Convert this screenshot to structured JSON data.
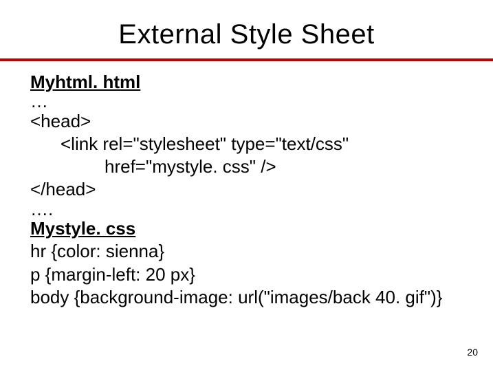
{
  "title": "External Style Sheet",
  "file1": "Myhtml. html",
  "dots1": "…",
  "line_head_open": "<head>",
  "line_link1": "<link rel=\"stylesheet\" type=\"text/css\"",
  "line_link2": "href=\"mystyle. css\" />",
  "line_head_close": "</head>",
  "dots2": "….",
  "file2": "Mystyle. css",
  "css_line1": "hr {color: sienna}",
  "css_line2": "p {margin-left: 20 px}",
  "css_line3": "body {background-image: url(\"images/back 40. gif\")}",
  "page_number": "20"
}
